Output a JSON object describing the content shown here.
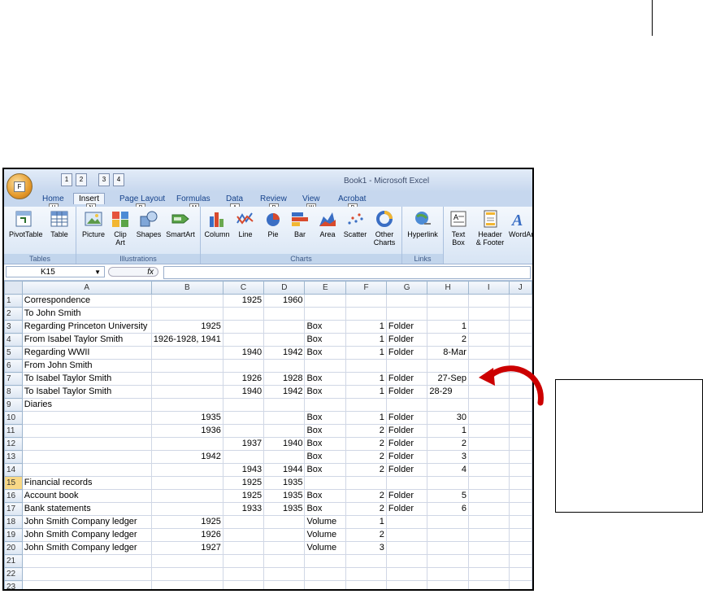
{
  "window": {
    "title": "Book1 - Microsoft Excel"
  },
  "office_button": {
    "key": "F"
  },
  "qat": {
    "keys": [
      "1",
      "2",
      "3",
      "4"
    ]
  },
  "tabs": [
    {
      "label": "Home",
      "key": "H"
    },
    {
      "label": "Insert",
      "key": "N"
    },
    {
      "label": "Page Layout",
      "key": "P"
    },
    {
      "label": "Formulas",
      "key": "M"
    },
    {
      "label": "Data",
      "key": "A"
    },
    {
      "label": "Review",
      "key": "R"
    },
    {
      "label": "View",
      "key": "W"
    },
    {
      "label": "Acrobat",
      "key": "B"
    }
  ],
  "ribbon": {
    "groups": {
      "tables": "Tables",
      "illustrations": "Illustrations",
      "charts": "Charts",
      "links": "Links"
    },
    "buttons": {
      "pivottable": "PivotTable",
      "table": "Table",
      "picture": "Picture",
      "clip_art_1": "Clip",
      "clip_art_2": "Art",
      "shapes": "Shapes",
      "smartart": "SmartArt",
      "column": "Column",
      "line": "Line",
      "pie": "Pie",
      "bar": "Bar",
      "area": "Area",
      "scatter": "Scatter",
      "other_charts_1": "Other",
      "other_charts_2": "Charts",
      "hyperlink": "Hyperlink",
      "text_box_1": "Text",
      "text_box_2": "Box",
      "header_footer_1": "Header",
      "header_footer_2": "& Footer",
      "wordart": "WordArt"
    }
  },
  "formula_bar": {
    "name_box": "K15",
    "fx": "fx",
    "value": ""
  },
  "sheet": {
    "columns": [
      "A",
      "B",
      "C",
      "D",
      "E",
      "F",
      "G",
      "H",
      "I",
      "J"
    ],
    "selected_row": 15,
    "rows": [
      {
        "n": "1",
        "A": "Correspondence",
        "B": "",
        "C": "1925",
        "D": "1960",
        "E": "",
        "F": "",
        "G": "",
        "H": ""
      },
      {
        "n": "2",
        "A": "To John Smith",
        "B": "",
        "C": "",
        "D": "",
        "E": "",
        "F": "",
        "G": "",
        "H": ""
      },
      {
        "n": "3",
        "A": "Regarding Princeton University",
        "B": "1925",
        "C": "",
        "D": "",
        "E": "Box",
        "F": "1",
        "G": "Folder",
        "H": "1"
      },
      {
        "n": "4",
        "A": "From Isabel Taylor Smith",
        "B": "1926-1928, 1941",
        "C": "",
        "D": "",
        "E": "Box",
        "F": "1",
        "G": "Folder",
        "H": "2"
      },
      {
        "n": "5",
        "A": "Regarding WWII",
        "B": "",
        "C": "1940",
        "D": "1942",
        "E": "Box",
        "F": "1",
        "G": "Folder",
        "H": "8-Mar"
      },
      {
        "n": "6",
        "A": "From John Smith",
        "B": "",
        "C": "",
        "D": "",
        "E": "",
        "F": "",
        "G": "",
        "H": ""
      },
      {
        "n": "7",
        "A": "To Isabel Taylor Smith",
        "B": "",
        "C": "1926",
        "D": "1928",
        "E": "Box",
        "F": "1",
        "G": "Folder",
        "H": "27-Sep"
      },
      {
        "n": "8",
        "A": "To Isabel Taylor Smith",
        "B": "",
        "C": "1940",
        "D": "1942",
        "E": "Box",
        "F": "1",
        "G": "Folder",
        "H": "28-29"
      },
      {
        "n": "9",
        "A": "Diaries",
        "B": "",
        "C": "",
        "D": "",
        "E": "",
        "F": "",
        "G": "",
        "H": ""
      },
      {
        "n": "10",
        "A": "",
        "B": "1935",
        "C": "",
        "D": "",
        "E": "Box",
        "F": "1",
        "G": "Folder",
        "H": "30"
      },
      {
        "n": "11",
        "A": "",
        "B": "1936",
        "C": "",
        "D": "",
        "E": "Box",
        "F": "2",
        "G": "Folder",
        "H": "1"
      },
      {
        "n": "12",
        "A": "",
        "B": "",
        "C": "1937",
        "D": "1940",
        "E": "Box",
        "F": "2",
        "G": "Folder",
        "H": "2"
      },
      {
        "n": "13",
        "A": "",
        "B": "1942",
        "C": "",
        "D": "",
        "E": "Box",
        "F": "2",
        "G": "Folder",
        "H": "3"
      },
      {
        "n": "14",
        "A": "",
        "B": "",
        "C": "1943",
        "D": "1944",
        "E": "Box",
        "F": "2",
        "G": "Folder",
        "H": "4"
      },
      {
        "n": "15",
        "A": "Financial records",
        "B": "",
        "C": "1925",
        "D": "1935",
        "E": "",
        "F": "",
        "G": "",
        "H": ""
      },
      {
        "n": "16",
        "A": "Account book",
        "B": "",
        "C": "1925",
        "D": "1935",
        "E": "Box",
        "F": "2",
        "G": "Folder",
        "H": "5"
      },
      {
        "n": "17",
        "A": "Bank statements",
        "B": "",
        "C": "1933",
        "D": "1935",
        "E": "Box",
        "F": "2",
        "G": "Folder",
        "H": "6"
      },
      {
        "n": "18",
        "A": "John Smith Company ledger",
        "B": "1925",
        "C": "",
        "D": "",
        "E": "Volume",
        "F": "1",
        "G": "",
        "H": ""
      },
      {
        "n": "19",
        "A": "John Smith Company ledger",
        "B": "1926",
        "C": "",
        "D": "",
        "E": "Volume",
        "F": "2",
        "G": "",
        "H": ""
      },
      {
        "n": "20",
        "A": "John Smith Company ledger",
        "B": "1927",
        "C": "",
        "D": "",
        "E": "Volume",
        "F": "3",
        "G": "",
        "H": ""
      },
      {
        "n": "21",
        "A": "",
        "B": "",
        "C": "",
        "D": "",
        "E": "",
        "F": "",
        "G": "",
        "H": ""
      },
      {
        "n": "22",
        "A": "",
        "B": "",
        "C": "",
        "D": "",
        "E": "",
        "F": "",
        "G": "",
        "H": ""
      },
      {
        "n": "23",
        "A": "",
        "B": "",
        "C": "",
        "D": "",
        "E": "",
        "F": "",
        "G": "",
        "H": ""
      }
    ]
  },
  "colors": {
    "arrow": "#cc0000",
    "selected_row_header": "#f8d886"
  },
  "callout": {
    "text": ""
  }
}
